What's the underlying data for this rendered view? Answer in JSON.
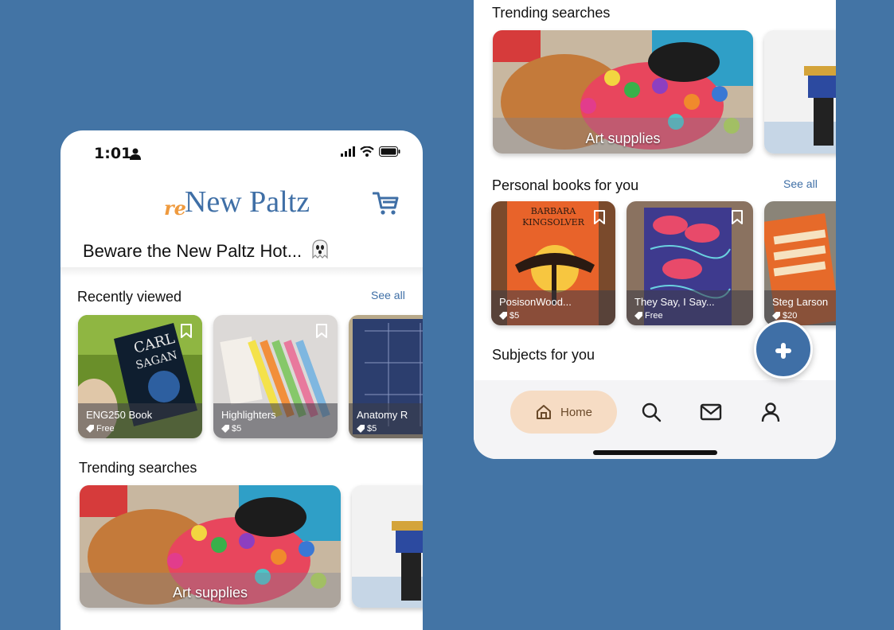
{
  "colors": {
    "background": "#4374a5",
    "accent": "#3f6fa6",
    "brand_orange": "#ef9a3e",
    "home_pill": "#f6dcc4"
  },
  "left_screen": {
    "status": {
      "time": "1:01"
    },
    "logo": {
      "prefix": "re",
      "name": "New Paltz"
    },
    "announcement": "Beware the New Paltz Hot...",
    "recently_viewed": {
      "title": "Recently viewed",
      "see_all": "See all",
      "items": [
        {
          "title": "ENG250 Book",
          "price": "Free"
        },
        {
          "title": "Highlighters",
          "price": "$5"
        },
        {
          "title": "Anatomy R",
          "price": "$5"
        }
      ]
    },
    "trending": {
      "title": "Trending searches",
      "items": [
        {
          "label": "Art supplies"
        }
      ]
    }
  },
  "right_screen": {
    "trending": {
      "title": "Trending searches",
      "items": [
        {
          "label": "Art supplies"
        }
      ]
    },
    "personal_books": {
      "title": "Personal books for you",
      "see_all": "See all",
      "items": [
        {
          "title": "PosisonWood...",
          "price": "$5"
        },
        {
          "title": "They Say, I Say...",
          "price": "Free"
        },
        {
          "title": "Steg Larson",
          "price": "$20"
        }
      ]
    },
    "subjects": {
      "title": "Subjects for you"
    },
    "nav": {
      "home_label": "Home"
    }
  }
}
